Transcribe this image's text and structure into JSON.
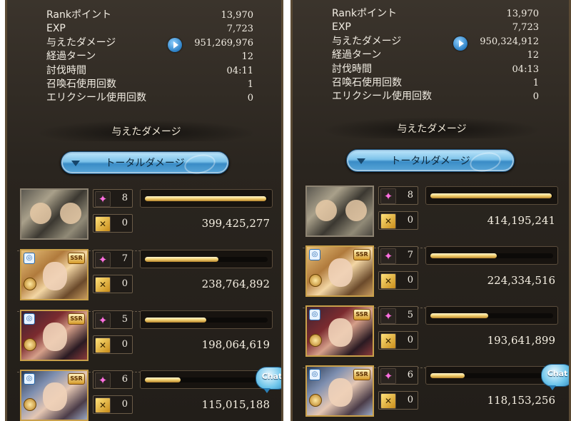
{
  "panels": [
    {
      "stats": [
        {
          "label": "Rankポイント",
          "value": "13,970"
        },
        {
          "label": "EXP",
          "value": "7,723"
        },
        {
          "label": "与えたダメージ",
          "value": "951,269,976"
        },
        {
          "label": "経過ターン",
          "value": "12"
        },
        {
          "label": "討伐時間",
          "value": "04:11"
        },
        {
          "label": "召喚石使用回数",
          "value": "1"
        },
        {
          "label": "エリクシール使用回数",
          "value": "0"
        }
      ],
      "section_title": "与えたダメージ",
      "tab_label": "トータルダメージ",
      "characters": [
        {
          "ougi": "8",
          "chain": "0",
          "damage": "399,425,277",
          "fill": 0.99
        },
        {
          "ougi": "7",
          "chain": "0",
          "damage": "238,764,892",
          "fill": 0.6
        },
        {
          "ougi": "5",
          "chain": "0",
          "damage": "198,064,619",
          "fill": 0.5
        },
        {
          "ougi": "6",
          "chain": "0",
          "damage": "115,015,188",
          "fill": 0.29
        }
      ],
      "chat_label": "Chat"
    },
    {
      "stats": [
        {
          "label": "Rankポイント",
          "value": "13,970"
        },
        {
          "label": "EXP",
          "value": "7,723"
        },
        {
          "label": "与えたダメージ",
          "value": "950,324,912"
        },
        {
          "label": "経過ターン",
          "value": "12"
        },
        {
          "label": "討伐時間",
          "value": "04:13"
        },
        {
          "label": "召喚石使用回数",
          "value": "1"
        },
        {
          "label": "エリクシール使用回数",
          "value": "0"
        }
      ],
      "section_title": "与えたダメージ",
      "tab_label": "トータルダメージ",
      "characters": [
        {
          "ougi": "8",
          "chain": "0",
          "damage": "414,195,241",
          "fill": 0.99
        },
        {
          "ougi": "7",
          "chain": "0",
          "damage": "224,334,516",
          "fill": 0.54
        },
        {
          "ougi": "5",
          "chain": "0",
          "damage": "193,641,899",
          "fill": 0.47
        },
        {
          "ougi": "6",
          "chain": "0",
          "damage": "118,153,256",
          "fill": 0.28
        }
      ],
      "chat_label": "Chat"
    }
  ],
  "colors": {
    "accent_blue": "#5aa6d8",
    "bar_gold": "#f1cf6f",
    "ougi_star": "#ff6fe0",
    "panel_bg": "#2a251f"
  },
  "icons": [
    "play-icon",
    "chevron-down-icon",
    "ougi-star-icon",
    "chain-burst-icon",
    "element-ring-icon",
    "ssr-badge-icon",
    "chat-icon"
  ]
}
